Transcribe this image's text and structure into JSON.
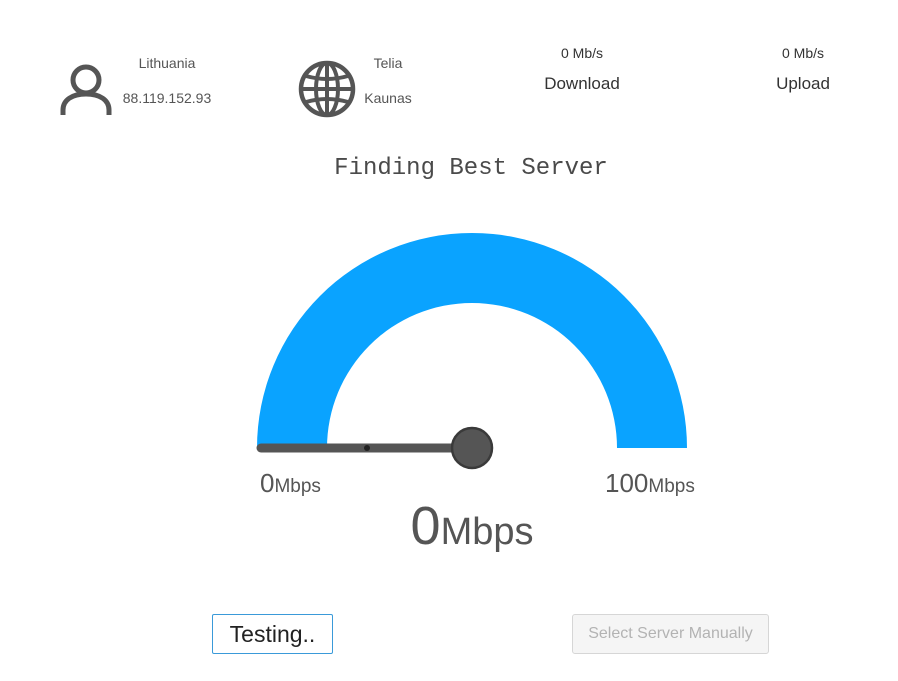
{
  "client": {
    "icon": "user-icon",
    "country": "Lithuania",
    "ip": "88.119.152.93"
  },
  "isp": {
    "icon": "globe-icon",
    "name": "Telia",
    "city": "Kaunas"
  },
  "download": {
    "value": "0 Mb/s",
    "label": "Download"
  },
  "upload": {
    "value": "0 Mb/s",
    "label": "Upload"
  },
  "status": "Finding Best Server",
  "gauge": {
    "min_value": "0",
    "min_unit": "Mbps",
    "max_value": "100",
    "max_unit": "Mbps",
    "current_value": "0",
    "current_unit": "Mbps",
    "fill_fraction": 1.0,
    "needle_fraction": 0.0,
    "arc_color": "#0aa3ff",
    "needle_color": "#555555"
  },
  "buttons": {
    "testing_label": "Testing..",
    "select_server_label": "Select Server Manually"
  }
}
